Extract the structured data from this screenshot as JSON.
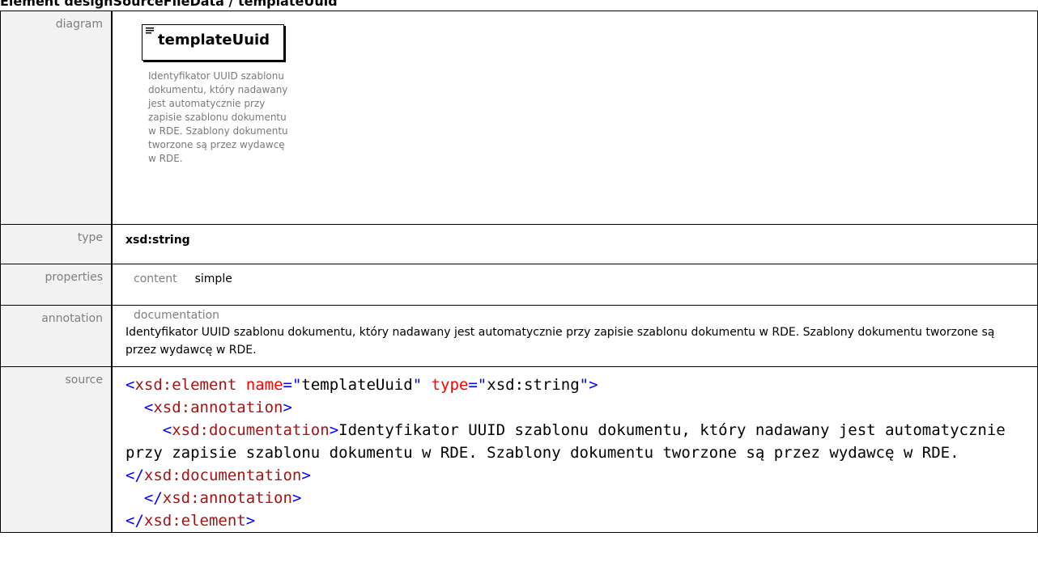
{
  "heading": "Element designSourceFileData / templateUuid",
  "rows": {
    "diagram": {
      "label": "diagram",
      "element_name": "templateUuid",
      "doc": "Identyfikator UUID szablonu dokumentu, który nadawany jest automatycznie przy zapisie szablonu dokumentu w RDE. Szablony dokumentu tworzone są przez wydawcę w RDE."
    },
    "type": {
      "label": "type",
      "value": "xsd:string"
    },
    "properties": {
      "label": "properties",
      "key": "content",
      "value": "simple"
    },
    "annotation": {
      "label": "annotation",
      "heading": "documentation",
      "text": "Identyfikator UUID szablonu dokumentu, który nadawany jest automatycznie przy zapisie szablonu dokumentu w RDE. Szablony dokumentu tworzone są przez wydawcę w RDE."
    },
    "source": {
      "label": "source",
      "tokens": [
        {
          "t": "bracket",
          "v": "<"
        },
        {
          "t": "tag",
          "v": "xsd:element"
        },
        {
          "t": "text",
          "v": " "
        },
        {
          "t": "attr",
          "v": "name"
        },
        {
          "t": "bracket",
          "v": "=\""
        },
        {
          "t": "val",
          "v": "templateUuid"
        },
        {
          "t": "bracket",
          "v": "\""
        },
        {
          "t": "text",
          "v": " "
        },
        {
          "t": "attr",
          "v": "type"
        },
        {
          "t": "bracket",
          "v": "=\""
        },
        {
          "t": "val",
          "v": "xsd:string"
        },
        {
          "t": "bracket",
          "v": "\">"
        },
        {
          "t": "text",
          "v": "\n  "
        },
        {
          "t": "bracket",
          "v": "<"
        },
        {
          "t": "tag",
          "v": "xsd:annotation"
        },
        {
          "t": "bracket",
          "v": ">"
        },
        {
          "t": "text",
          "v": "\n    "
        },
        {
          "t": "bracket",
          "v": "<"
        },
        {
          "t": "tag",
          "v": "xsd:documentation"
        },
        {
          "t": "bracket",
          "v": ">"
        },
        {
          "t": "text",
          "v": "Identyfikator UUID szablonu dokumentu, który nadawany jest automatycznie przy zapisie szablonu dokumentu w RDE. Szablony dokumentu tworzone są przez wydawcę w RDE."
        },
        {
          "t": "bracket",
          "v": "</"
        },
        {
          "t": "tag",
          "v": "xsd:documentation"
        },
        {
          "t": "bracket",
          "v": ">"
        },
        {
          "t": "text",
          "v": "\n  "
        },
        {
          "t": "bracket",
          "v": "</"
        },
        {
          "t": "tag",
          "v": "xsd:annotation"
        },
        {
          "t": "bracket",
          "v": ">"
        },
        {
          "t": "text",
          "v": "\n"
        },
        {
          "t": "bracket",
          "v": "</"
        },
        {
          "t": "tag",
          "v": "xsd:element"
        },
        {
          "t": "bracket",
          "v": ">"
        }
      ]
    }
  }
}
